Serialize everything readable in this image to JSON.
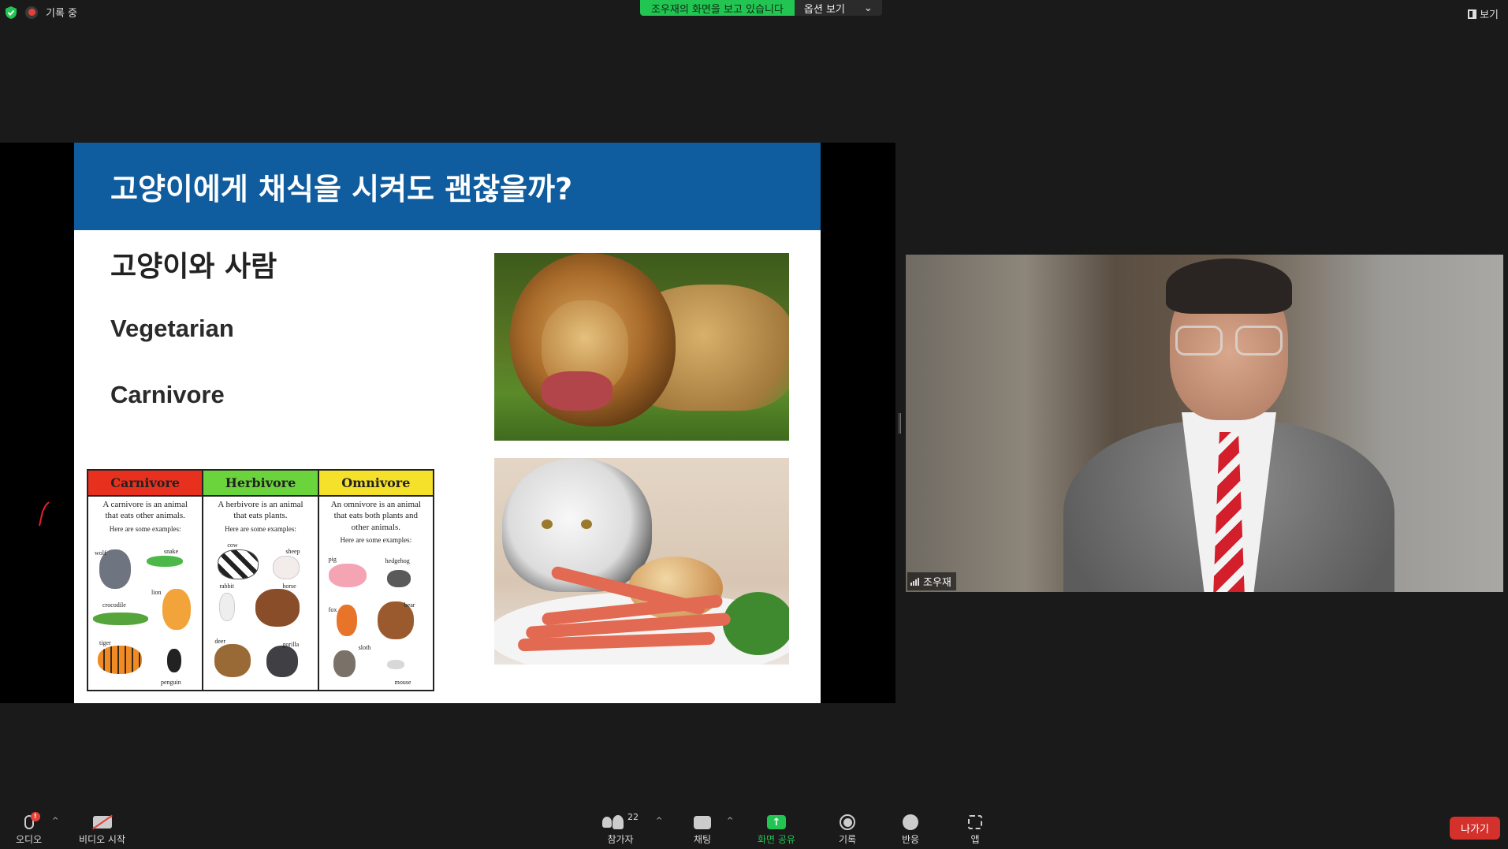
{
  "top": {
    "recording_label": "기록 중",
    "share_banner": "조우재의 화면을 보고 있습니다",
    "view_options": "옵션 보기",
    "view_button": "보기"
  },
  "slide": {
    "title": "고양이에게 채식을 시켜도 괜찮을까?",
    "subtitle": "고양이와 사람",
    "word1": "Vegetarian",
    "word2": "Carnivore",
    "chart": {
      "columns": [
        {
          "header": "Carnivore",
          "color": "#e8301f",
          "line1": "A carnivore is an animal",
          "line2": "that eats other animals.",
          "examples": "Here are some examples:",
          "animals": [
            "wolf",
            "snake",
            "lion",
            "crocodile",
            "tiger",
            "penguin"
          ]
        },
        {
          "header": "Herbivore",
          "color": "#6bd33b",
          "line1": "A herbivore is an animal",
          "line2": "that eats plants.",
          "examples": "Here are some examples:",
          "animals": [
            "cow",
            "sheep",
            "rabbit",
            "horse",
            "deer",
            "gorilla"
          ]
        },
        {
          "header": "Omnivore",
          "color": "#f5e02a",
          "line1": "An omnivore is an animal",
          "line2": "that eats both plants and",
          "line3": "other animals.",
          "examples": "Here are some examples:",
          "animals": [
            "pig",
            "hedgehog",
            "fox",
            "bear",
            "sloth",
            "mouse"
          ]
        }
      ]
    }
  },
  "video": {
    "participant_name": "조우재"
  },
  "toolbar": {
    "audio": "오디오",
    "video": "비디오 시작",
    "participants": "참가자",
    "participant_count": "22",
    "chat": "채팅",
    "share": "화면 공유",
    "record": "기록",
    "reactions": "반응",
    "apps": "앱",
    "leave": "나가기",
    "mic_badge": "!"
  },
  "colors": {
    "slide_header": "#0f5c9e",
    "share_green": "#23c552",
    "leave_red": "#d4302c"
  }
}
